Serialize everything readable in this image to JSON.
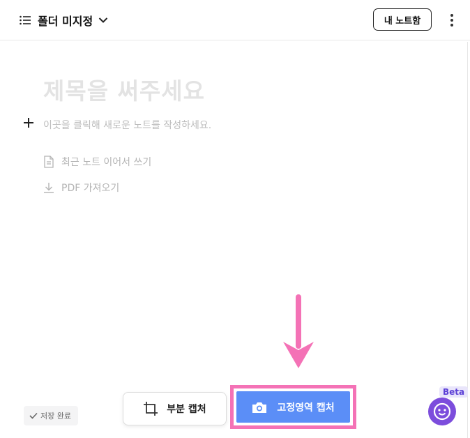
{
  "header": {
    "folder_label": "폴더 미지정",
    "my_notes_label": "내 노트함"
  },
  "editor": {
    "title_placeholder": "제목을 써주세요",
    "body_placeholder": "이곳을 클릭해 새로운 노트를 작성하세요.",
    "options": [
      {
        "label": "최근 노트 이어서 쓰기",
        "icon": "document-icon"
      },
      {
        "label": "PDF 가져오기",
        "icon": "download-icon"
      }
    ]
  },
  "footer": {
    "save_status": "저장 완료",
    "partial_capture_label": "부분 캡처",
    "fixed_capture_label": "고정영역 캡처",
    "beta_label": "Beta"
  },
  "colors": {
    "primary": "#5b8ef7",
    "highlight": "#f472b6",
    "chatbot": "#7c4ddc"
  }
}
